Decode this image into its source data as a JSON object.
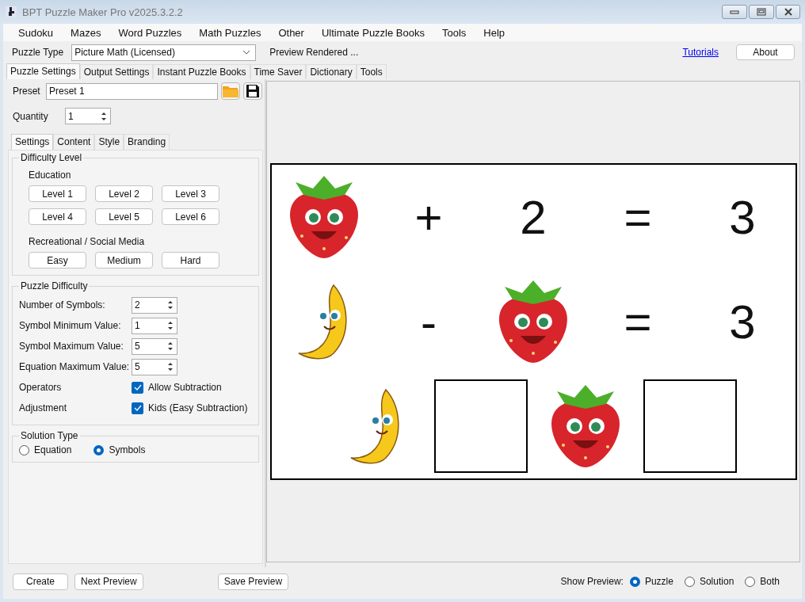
{
  "window": {
    "title": "BPT Puzzle Maker Pro v2025.3.2.2"
  },
  "menu": [
    "Sudoku",
    "Mazes",
    "Word Puzzles",
    "Math Puzzles",
    "Other",
    "Ultimate Puzzle Books",
    "Tools",
    "Help"
  ],
  "toolbar": {
    "puzzle_type_label": "Puzzle Type",
    "puzzle_type": "Picture Math (Licensed)",
    "status": "Preview Rendered ...",
    "tutorials_link": "Tutorials",
    "about_button": "About"
  },
  "main_tabs": [
    {
      "label": "Puzzle Settings",
      "selected": true
    },
    {
      "label": "Output Settings",
      "selected": false
    },
    {
      "label": "Instant Puzzle Books",
      "selected": false
    },
    {
      "label": "Time Saver",
      "selected": false
    },
    {
      "label": "Dictionary",
      "selected": false
    },
    {
      "label": "Tools",
      "selected": false
    }
  ],
  "preset": {
    "label": "Preset",
    "value": "Preset 1"
  },
  "quantity": {
    "label": "Quantity",
    "value": "1"
  },
  "sub_tabs": [
    {
      "label": "Settings",
      "selected": true
    },
    {
      "label": "Content",
      "selected": false
    },
    {
      "label": "Style",
      "selected": false
    },
    {
      "label": "Branding",
      "selected": false
    }
  ],
  "difficulty_level": {
    "title": "Difficulty Level",
    "education_label": "Education",
    "education_buttons": [
      "Level 1",
      "Level 2",
      "Level 3",
      "Level 4",
      "Level 5",
      "Level 6"
    ],
    "recreational_label": "Recreational / Social Media",
    "recreational_buttons": [
      "Easy",
      "Medium",
      "Hard"
    ]
  },
  "puzzle_difficulty": {
    "title": "Puzzle Difficulty",
    "spinners": [
      {
        "label": "Number of Symbols:",
        "value": "2"
      },
      {
        "label": "Symbol Minimum Value:",
        "value": "1"
      },
      {
        "label": "Symbol Maximum Value:",
        "value": "5"
      },
      {
        "label": "Equation Maximum Value:",
        "value": "5"
      }
    ],
    "options": [
      {
        "label": "Operators",
        "checkbox_label": "Allow Subtraction",
        "checked": true
      },
      {
        "label": "Adjustment",
        "checkbox_label": "Kids (Easy Subtraction)",
        "checked": true
      }
    ]
  },
  "solution_type": {
    "title": "Solution Type",
    "options": [
      {
        "label": "Equation",
        "selected": false
      },
      {
        "label": "Symbols",
        "selected": true
      }
    ]
  },
  "preview": {
    "rows": [
      [
        {
          "kind": "strawberry"
        },
        {
          "kind": "text",
          "text": "+"
        },
        {
          "kind": "text",
          "text": "2"
        },
        {
          "kind": "text",
          "text": "="
        },
        {
          "kind": "text",
          "text": "3"
        }
      ],
      [
        {
          "kind": "banana"
        },
        {
          "kind": "text",
          "text": "-"
        },
        {
          "kind": "strawberry"
        },
        {
          "kind": "text",
          "text": "="
        },
        {
          "kind": "text",
          "text": "3"
        }
      ],
      [
        {
          "kind": "banana"
        },
        {
          "kind": "blank"
        },
        {
          "kind": "strawberry"
        },
        {
          "kind": "blank"
        }
      ]
    ]
  },
  "bottom": {
    "buttons": [
      "Create",
      "Next Preview"
    ],
    "save_button": "Save Preview",
    "show_preview_label": "Show Preview:",
    "options": [
      {
        "label": "Puzzle",
        "selected": true
      },
      {
        "label": "Solution",
        "selected": false
      },
      {
        "label": "Both",
        "selected": false
      }
    ]
  }
}
